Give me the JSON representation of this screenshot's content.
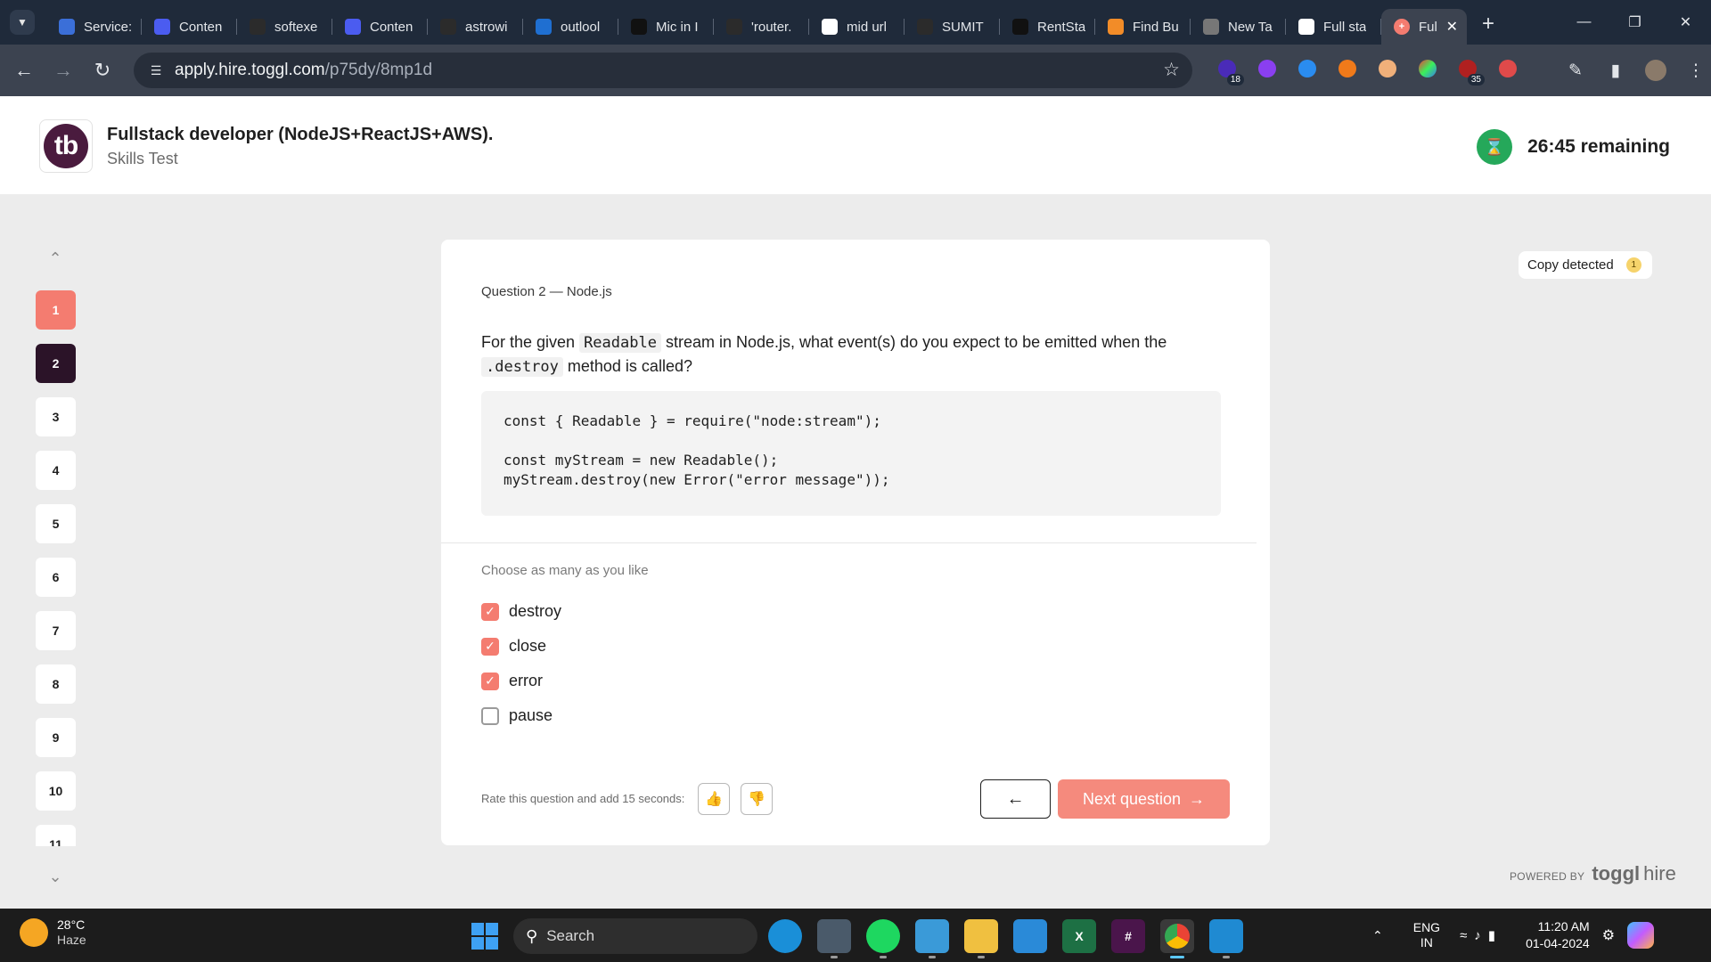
{
  "browser": {
    "tabs": [
      {
        "label": "Service:",
        "icon": "s-icon",
        "color": "#3b6fd8"
      },
      {
        "label": "Conten",
        "icon": "content-icon",
        "color": "#4b5cf0"
      },
      {
        "label": "softexe",
        "icon": "github-icon",
        "color": "#2b2b2b"
      },
      {
        "label": "Conten",
        "icon": "content-icon",
        "color": "#4b5cf0"
      },
      {
        "label": "astrowi",
        "icon": "github-icon",
        "color": "#2b2b2b"
      },
      {
        "label": "outlool",
        "icon": "outlook-icon",
        "color": "#1f6fd1"
      },
      {
        "label": "Mic in I",
        "icon": "ola-icon",
        "color": "#111111"
      },
      {
        "label": "'router.",
        "icon": "github-icon",
        "color": "#2b2b2b"
      },
      {
        "label": "mid url",
        "icon": "google-icon",
        "color": "#ffffff"
      },
      {
        "label": "SUMIT",
        "icon": "github-icon",
        "color": "#2b2b2b"
      },
      {
        "label": "RentSta",
        "icon": "triangle-icon",
        "color": "#111111"
      },
      {
        "label": "Find Bu",
        "icon": "jd-icon",
        "color": "#f28c28"
      },
      {
        "label": "New Ta",
        "icon": "chrome-icon",
        "color": "#777777"
      },
      {
        "label": "Full sta",
        "icon": "gmail-icon",
        "color": "#ffffff"
      }
    ],
    "active_tab": {
      "label": "Ful",
      "icon": "toggl-hire-icon",
      "color": "#f47c70"
    },
    "url_host": "apply.hire.toggl.com",
    "url_path": "/p75dy/8mp1d",
    "extension_badges": {
      "first": "18",
      "second": "35"
    }
  },
  "header": {
    "logo_text": "tb",
    "job_title": "Fullstack developer (NodeJS+ReactJS+AWS).",
    "subtitle": "Skills Test",
    "timer": "26:45 remaining"
  },
  "navigator": {
    "questions": [
      "1",
      "2",
      "3",
      "4",
      "5",
      "6",
      "7",
      "8",
      "9",
      "10",
      "11"
    ],
    "answered": [
      "1"
    ],
    "current": "2"
  },
  "copy_detected": {
    "label": "Copy detected",
    "count": "1"
  },
  "question": {
    "label": "Question 2 — Node.js",
    "text_before": "For the given ",
    "code_inline_1": "Readable",
    "text_middle": " stream in Node.js, what event(s) do you expect to be emitted when the ",
    "code_inline_2": ".destroy",
    "text_after": " method is called?",
    "code": "const { Readable } = require(\"node:stream\");\n\nconst myStream = new Readable();\nmyStream.destroy(new Error(\"error message\"));",
    "hint": "Choose as many as you like",
    "options": [
      {
        "label": "destroy",
        "checked": true
      },
      {
        "label": "close",
        "checked": true
      },
      {
        "label": "error",
        "checked": true
      },
      {
        "label": "pause",
        "checked": false
      }
    ]
  },
  "footer": {
    "rate_text": "Rate this question and add 15 seconds:",
    "next_label": "Next question",
    "powered_label": "POWERED BY",
    "brand": "toggl",
    "brand_suffix": "hire"
  },
  "taskbar": {
    "temperature": "28°C",
    "weather": "Haze",
    "search": "Search",
    "lang_1": "ENG",
    "lang_2": "IN",
    "time": "11:20 AM",
    "date": "01-04-2024"
  }
}
